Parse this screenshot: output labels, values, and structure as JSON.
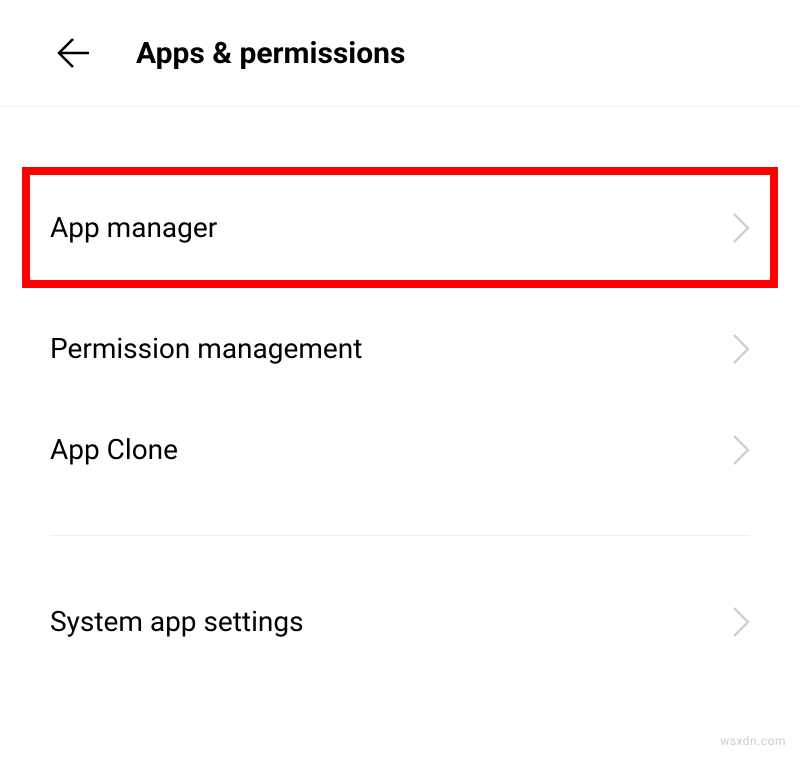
{
  "header": {
    "title": "Apps & permissions"
  },
  "items": [
    {
      "label": "App manager",
      "highlighted": true
    },
    {
      "label": "Permission management",
      "highlighted": false
    },
    {
      "label": "App Clone",
      "highlighted": false
    }
  ],
  "section2": [
    {
      "label": "System app settings",
      "highlighted": false
    }
  ],
  "watermark": "wsxdn.com"
}
